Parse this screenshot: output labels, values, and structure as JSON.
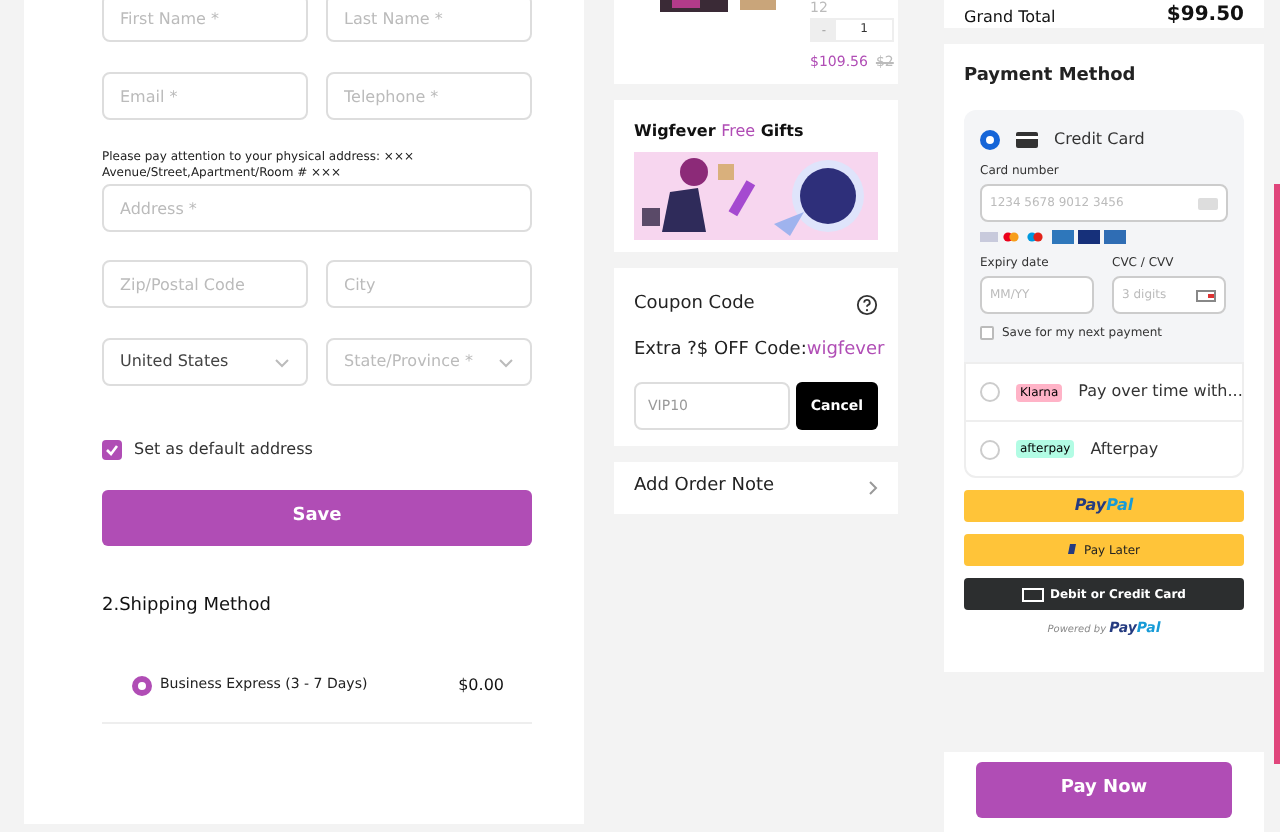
{
  "address_form": {
    "rows": [
      [
        {
          "placeholder": "First Name *",
          "kind": "text"
        },
        {
          "placeholder": "Last Name *",
          "kind": "text"
        }
      ],
      [
        {
          "placeholder": "Email *",
          "kind": "text"
        },
        {
          "placeholder": "Telephone *",
          "kind": "text"
        }
      ]
    ],
    "address_note": "Please pay attention to your physical address: ××× Avenue/Street,Apartment/Room # ×××",
    "address": {
      "placeholder": "Address *"
    },
    "rows2": [
      [
        {
          "placeholder": "Zip/Postal Code",
          "kind": "text"
        },
        {
          "placeholder": "City",
          "kind": "text"
        }
      ],
      [
        {
          "value": "United States",
          "kind": "select"
        },
        {
          "placeholder": "State/Province *",
          "kind": "select"
        }
      ]
    ],
    "default_address": {
      "label": "Set as default address",
      "checked": true
    },
    "save_button": "Save"
  },
  "shipping": {
    "title": "2.Shipping Method",
    "options": [
      {
        "label": "Business Express (3 - 7 Days)",
        "price": "$0.00",
        "selected": true
      }
    ]
  },
  "product": {
    "size": "12",
    "quantity": "1",
    "minus": "-",
    "price": "$109.56",
    "old_price": "$2"
  },
  "gifts": {
    "title_parts": [
      {
        "text": "Wigfever ",
        "accent": false
      },
      {
        "text": "Free",
        "accent": true
      },
      {
        "text": " Gifts",
        "accent": false
      }
    ]
  },
  "coupon": {
    "title": "Coupon Code",
    "promo_text": "Extra ?$ OFF Code:",
    "promo_code": "wigfever",
    "placeholder": "VIP10",
    "button": "Cancel"
  },
  "order_note": {
    "label": "Add Order Note"
  },
  "summary": {
    "label": "Grand Total",
    "value": "$99.50"
  },
  "payment": {
    "title": "Payment Method",
    "methods": [
      {
        "kind": "card",
        "label": "Credit Card",
        "selected": true,
        "card_number_label": "Card number",
        "card_number_placeholder": "1234 5678 9012 3456",
        "expiry_label": "Expiry date",
        "expiry_placeholder": "MM/YY",
        "cvc_label": "CVC / CVV",
        "cvc_placeholder": "3 digits",
        "save_label": "Save for my next payment",
        "save_checked": false
      },
      {
        "kind": "klarna",
        "label": "Pay over time with...",
        "badge": "Klarna",
        "selected": false
      },
      {
        "kind": "afterpay",
        "label": "Afterpay",
        "badge": "afterpay",
        "selected": false
      }
    ],
    "paypal": {
      "paypal_button": [
        "Pay",
        "Pal"
      ],
      "later_button": "Pay Later",
      "debit_button": "Debit or Credit Card",
      "powered_by": "Powered by",
      "powered_brand": [
        "Pay",
        "Pal"
      ]
    }
  },
  "pay_now": "Pay Now"
}
